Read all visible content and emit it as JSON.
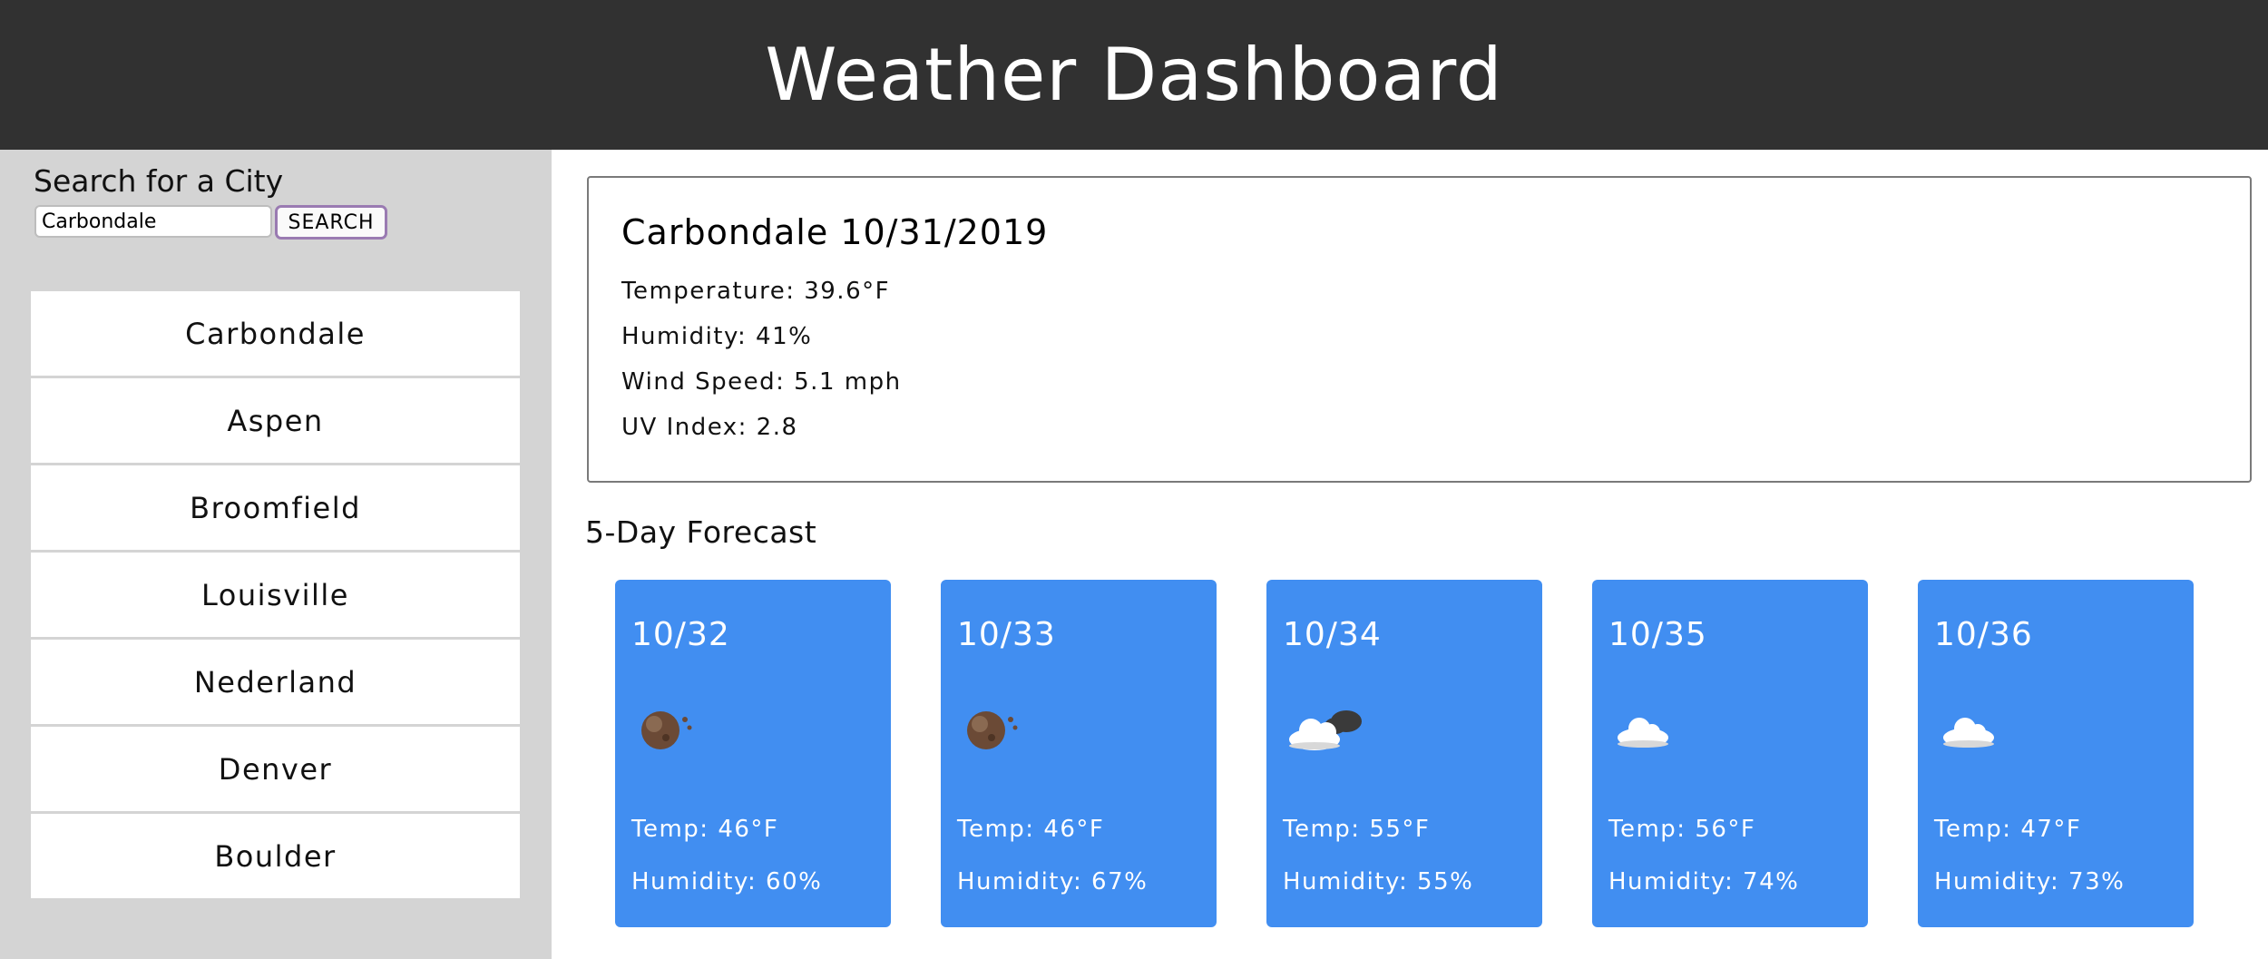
{
  "header": {
    "title": "Weather Dashboard"
  },
  "search": {
    "title": "Search for a City",
    "value": "Carbondale",
    "button_label": "SEARCH"
  },
  "cities": [
    "Carbondale",
    "Aspen",
    "Broomfield",
    "Louisville",
    "Nederland",
    "Denver",
    "Boulder"
  ],
  "current": {
    "title": "Carbondale 10/31/2019",
    "temperature": "Temperature: 39.6°F",
    "humidity": "Humidity: 41%",
    "wind": "Wind Speed: 5.1 mph",
    "uv": "UV Index: 2.8"
  },
  "forecast": {
    "title": "5-Day Forecast",
    "days": [
      {
        "date": "10/32",
        "icon": "moon-icon",
        "temp": "Temp: 46°F",
        "humidity": "Humidity: 60%"
      },
      {
        "date": "10/33",
        "icon": "moon-icon",
        "temp": "Temp: 46°F",
        "humidity": "Humidity: 67%"
      },
      {
        "date": "10/34",
        "icon": "cloudy-night-icon",
        "temp": "Temp: 55°F",
        "humidity": "Humidity: 55%"
      },
      {
        "date": "10/35",
        "icon": "cloud-icon",
        "temp": "Temp: 56°F",
        "humidity": "Humidity: 74%"
      },
      {
        "date": "10/36",
        "icon": "cloud-icon",
        "temp": "Temp: 47°F",
        "humidity": "Humidity: 73%"
      }
    ]
  },
  "colors": {
    "header_bg": "#313131",
    "sidebar_bg": "#d4d4d4",
    "card_bg": "#418ef1"
  }
}
